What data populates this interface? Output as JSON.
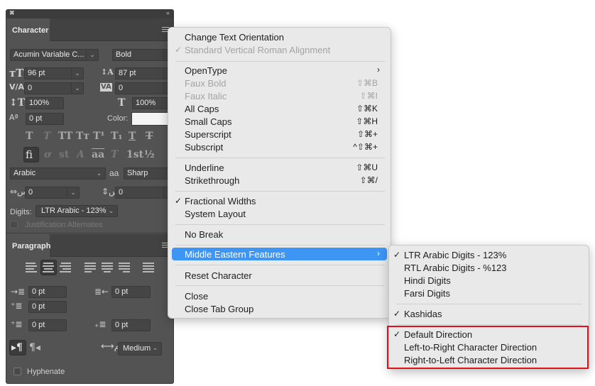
{
  "panel": {
    "character_tab": "Character",
    "paragraph_tab": "Paragraph",
    "font_family": "Acumin Variable C...",
    "font_style": "Bold",
    "font_size": "96 pt",
    "leading": "87 pt",
    "kerning": "0",
    "tracking": "0",
    "vertical_scale": "100%",
    "horizontal_scale": "100%",
    "baseline_shift": "0 pt",
    "color_label": "Color:",
    "style_buttons": [
      "T",
      "T",
      "TT",
      "Tт",
      "T¹",
      "T₁",
      "T",
      "T"
    ],
    "opentype_buttons": [
      "fi",
      "ơ",
      "st",
      "A",
      "aa",
      "T",
      "1st",
      "½"
    ],
    "language": "Arabic",
    "antialias_icon": "aa",
    "antialias": "Sharp",
    "arabic_left_value": "0",
    "arabic_right_value": "0",
    "digits_label": "Digits:",
    "digits_value": "LTR Arabic - 123%",
    "justification_alternates": "Justification Alternates",
    "indent_left": "0 pt",
    "indent_right": "0 pt",
    "indent_first": "0 pt",
    "space_before": "0 pt",
    "space_after": "0 pt",
    "kashida_value": "Medium",
    "hyphenate": "Hyphenate"
  },
  "menu": {
    "items": [
      {
        "label": "Change Text Orientation",
        "shortcut": "",
        "checked": false,
        "disabled": false
      },
      {
        "label": "Standard Vertical Roman Alignment",
        "shortcut": "",
        "checked": true,
        "disabled": true
      },
      {
        "label": "OpenType",
        "shortcut": "",
        "submenu": true
      },
      {
        "label": "Faux Bold",
        "shortcut": "⇧⌘B",
        "disabled": true
      },
      {
        "label": "Faux Italic",
        "shortcut": "⇧⌘I",
        "disabled": true
      },
      {
        "label": "All Caps",
        "shortcut": "⇧⌘K"
      },
      {
        "label": "Small Caps",
        "shortcut": "⇧⌘H"
      },
      {
        "label": "Superscript",
        "shortcut": "⇧⌘+"
      },
      {
        "label": "Subscript",
        "shortcut": "^⇧⌘+"
      },
      {
        "label": "Underline",
        "shortcut": "⇧⌘U"
      },
      {
        "label": "Strikethrough",
        "shortcut": "⇧⌘/"
      },
      {
        "label": "Fractional Widths",
        "checked": true
      },
      {
        "label": "System Layout"
      },
      {
        "label": "No Break"
      },
      {
        "label": "Middle Eastern Features",
        "submenu": true,
        "highlighted": true
      },
      {
        "label": "Reset Character"
      },
      {
        "label": "Close"
      },
      {
        "label": "Close Tab Group"
      }
    ],
    "check_glyph": "✓",
    "arrow_glyph": "›"
  },
  "submenu": {
    "items": [
      {
        "label": "LTR Arabic Digits - 123%",
        "checked": true
      },
      {
        "label": "RTL Arabic Digits - %123"
      },
      {
        "label": "Hindi Digits"
      },
      {
        "label": "Farsi Digits"
      },
      {
        "label": "Kashidas",
        "checked": true
      },
      {
        "label": "Default Direction",
        "checked": true
      },
      {
        "label": "Left-to-Right Character Direction"
      },
      {
        "label": "Right-to-Left Character Direction"
      }
    ]
  },
  "colors": {
    "panel_bg": "#535353",
    "menu_bg": "#e9e9e9",
    "highlight": "#3d95f4",
    "annotation_box": "#e0131a"
  }
}
